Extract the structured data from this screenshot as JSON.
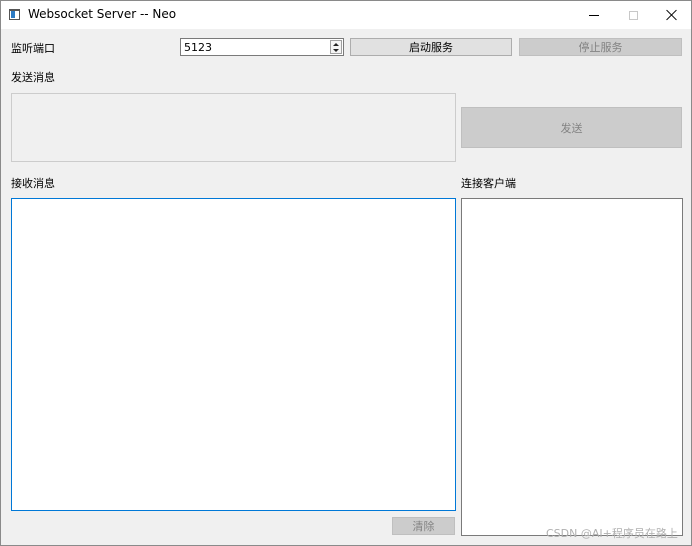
{
  "window": {
    "title": "Websocket Server -- Neo"
  },
  "port": {
    "label": "监听端口",
    "value": "5123"
  },
  "buttons": {
    "start": "启动服务",
    "stop": "停止服务",
    "send": "发送",
    "clear": "清除"
  },
  "send_section": {
    "label": "发送消息",
    "text": ""
  },
  "receive_section": {
    "label": "接收消息",
    "text": ""
  },
  "clients_section": {
    "label": "连接客户端",
    "items": []
  },
  "watermark": "CSDN @AI+程序员在路上",
  "colors": {
    "focus_border": "#0078d7",
    "background": "#f0f0f0",
    "disabled_button": "#cccccc"
  }
}
